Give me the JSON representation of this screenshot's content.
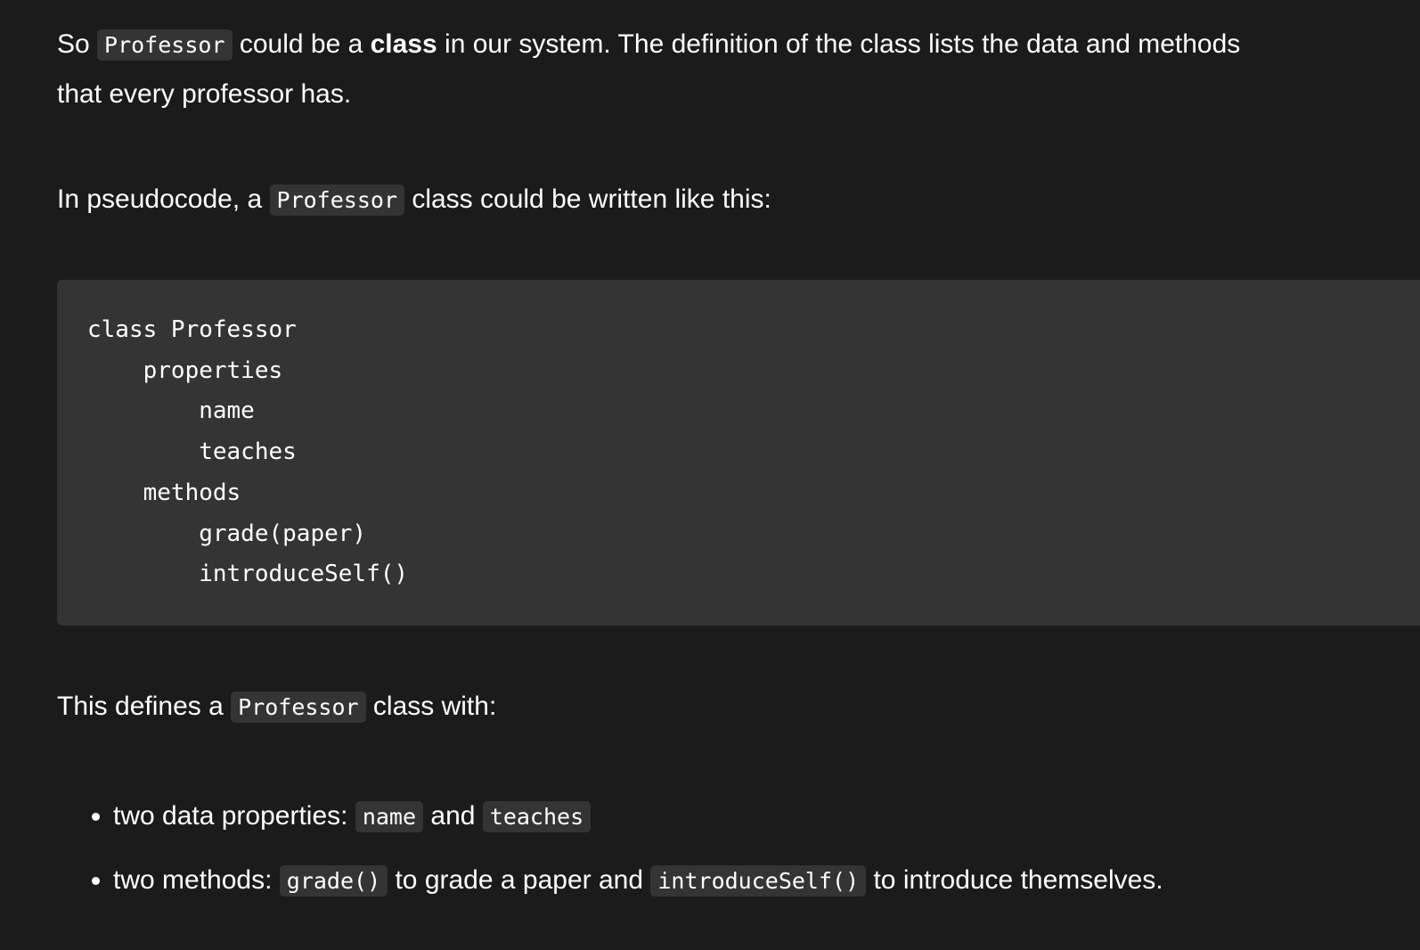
{
  "paragraph1": {
    "t1": "So ",
    "code1": "Professor",
    "t2": " could be a ",
    "bold": "class",
    "t3": " in our system. The definition of the class lists the data and methods",
    "t4": "that every professor has."
  },
  "paragraph2": {
    "t1": "In pseudocode, a ",
    "code1": "Professor",
    "t2": " class could be written like this:"
  },
  "code_block": {
    "lines": [
      "class Professor",
      "    properties",
      "        name",
      "        teaches",
      "    methods",
      "        grade(paper)",
      "        introduceSelf()"
    ]
  },
  "paragraph3": {
    "t1": "This defines a ",
    "code1": "Professor",
    "t2": " class with:"
  },
  "list": [
    {
      "t1": "two data properties: ",
      "code1": "name",
      "t2": " and ",
      "code2": "teaches",
      "t3": ""
    },
    {
      "t1": "two methods: ",
      "code1": "grade()",
      "t2": " to grade a paper and ",
      "code2": "introduceSelf()",
      "t3": " to introduce themselves."
    }
  ],
  "colors": {
    "background": "#1b1b1b",
    "code_background": "#343434",
    "text": "#ffffff"
  }
}
